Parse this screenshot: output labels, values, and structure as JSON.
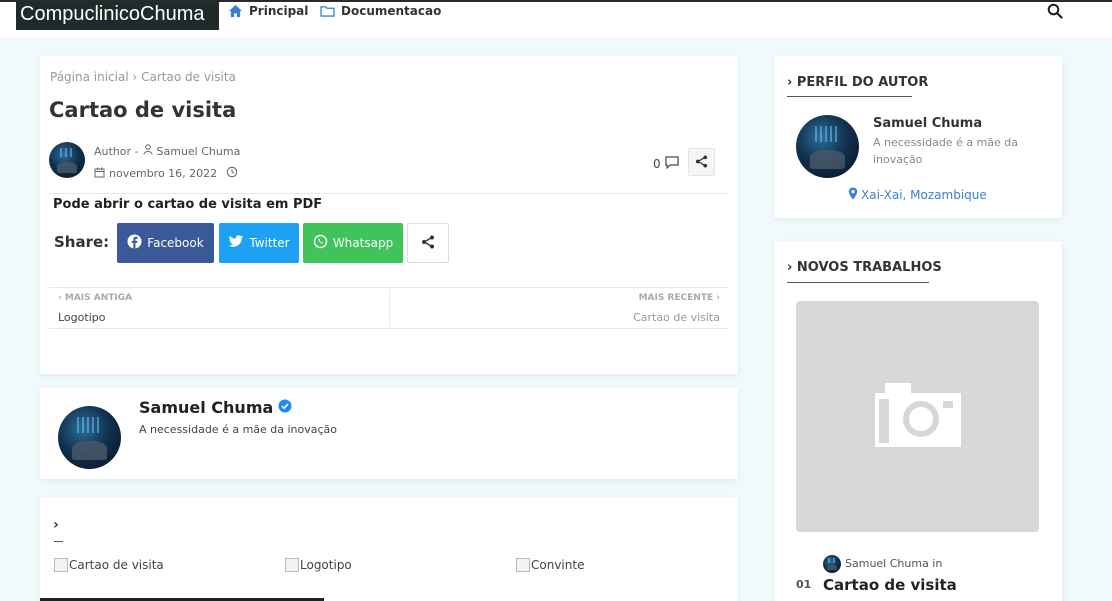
{
  "header": {
    "logo": "CompuclinicoChuma",
    "nav": [
      {
        "label": "Principal",
        "icon": "home-icon"
      },
      {
        "label": "Documentacao",
        "icon": "folder-icon"
      }
    ],
    "search_icon": "search-icon"
  },
  "post": {
    "breadcrumb": {
      "home": "Página inicial",
      "separator": "›",
      "current": "Cartao de visita"
    },
    "title": "Cartao de visita",
    "author_prefix": "Author -",
    "author": "Samuel Chuma",
    "date": "novembro 16, 2022",
    "comment_count": "0",
    "body_text": "Pode abrir o cartao de visita em PDF",
    "share_label": "Share:",
    "share_buttons": [
      {
        "label": "Facebook",
        "icon": "facebook-icon",
        "color": "#3b5998"
      },
      {
        "label": "Twitter",
        "icon": "twitter-icon",
        "color": "#1da1f2"
      },
      {
        "label": "Whatsapp",
        "icon": "whatsapp-icon",
        "color": "#3fc35a"
      }
    ],
    "prev": {
      "label": "MAIS ANTIGA",
      "title": "Logotipo"
    },
    "next": {
      "label": "MAIS RECENTE",
      "title": "Cartao de visita"
    }
  },
  "author_box": {
    "name": "Samuel Chuma",
    "description": "A necessidade é a mãe da inovação",
    "verified_color": "#1d8cf0"
  },
  "related": {
    "heading_icon": "›",
    "items": [
      "Cartao de visita",
      "Logotipo",
      "Convinte"
    ]
  },
  "sidebar": {
    "profile": {
      "title": "PERFIL DO AUTOR",
      "name": "Samuel Chuma",
      "description": "A necessidade é a mãe da inovação",
      "location": "Xai-Xai, Mozambique"
    },
    "new_works": {
      "title": "NOVOS TRABALHOS",
      "author_line": "Samuel Chuma in",
      "number": "01",
      "item_title": "Cartao de visita"
    }
  },
  "colors": {
    "accent": "#3b7fd8",
    "background": "#f0f9fb",
    "logo_bg": "#1f2a2a"
  }
}
